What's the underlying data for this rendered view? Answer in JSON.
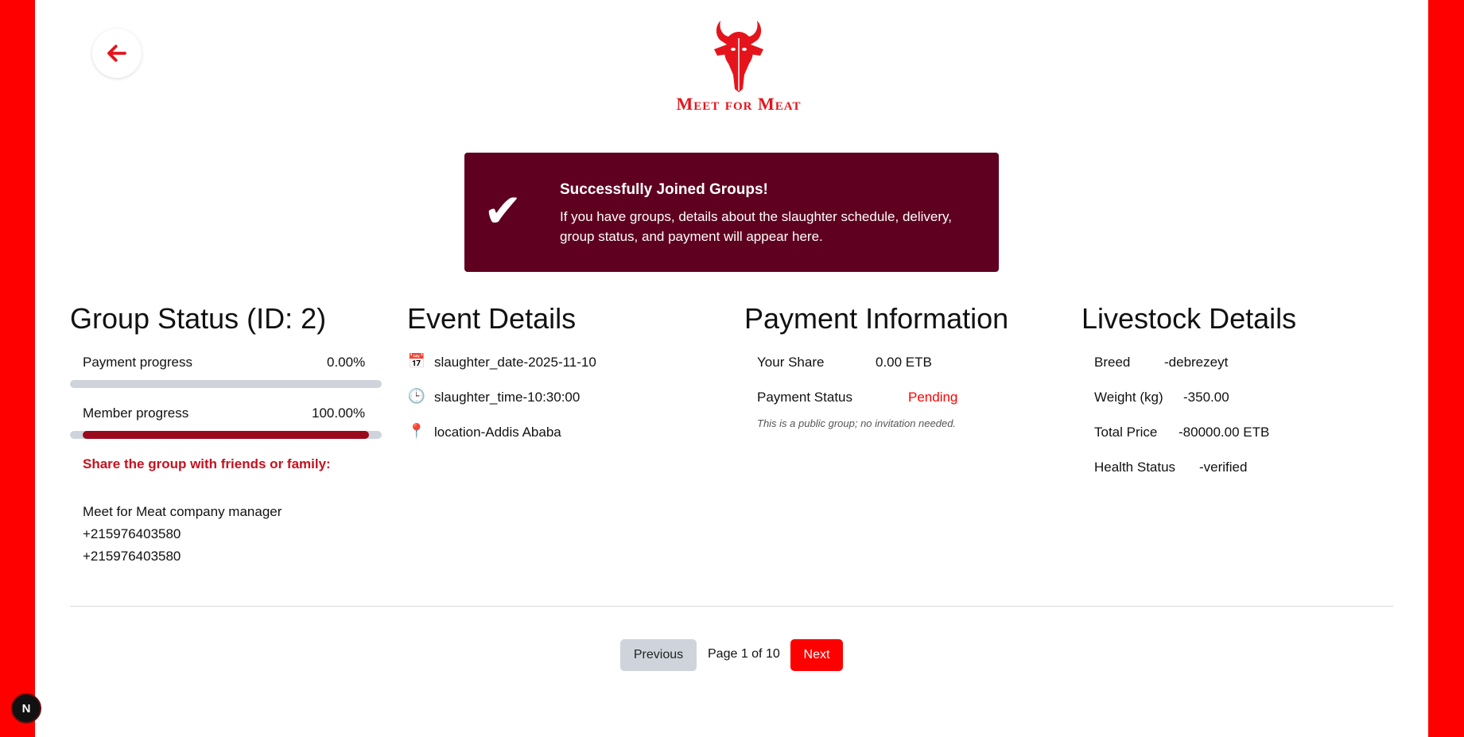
{
  "header": {
    "back_icon": "arrow-left-icon",
    "logo_text": "Meet for Meat",
    "logo_icon": "bull-head-icon",
    "brand_color": "#e5141c"
  },
  "banner": {
    "check_icon": "✔",
    "title": "Successfully Joined Groups!",
    "text": "If you have groups, details about the slaughter schedule, delivery, group status, and payment will appear here.",
    "background": "#5f0020"
  },
  "group_status": {
    "title": "Group Status (ID: 2)",
    "payment_label": "Payment progress",
    "payment_value": "0.00%",
    "payment_fraction": 0.0,
    "member_label": "Member progress",
    "member_value": "100.00%",
    "member_fraction": 1.0,
    "share_title": "Share the group with friends or family:",
    "contact_name": "Meet for Meat company manager",
    "phone_1": "+215976403580",
    "phone_2": "+215976403580"
  },
  "event": {
    "title": "Event Details",
    "date_icon": "📅",
    "date": "slaughter_date-2025-11-10",
    "time_icon": "🕒",
    "time": "slaughter_time-10:30:00",
    "location_icon": "📍",
    "location": "location-Addis Ababa"
  },
  "payment": {
    "title": "Payment Information",
    "share_label": "Your Share",
    "share_value": "0.00 ETB",
    "status_label": "Payment Status",
    "status_value": "Pending",
    "note": "This is a public group; no invitation needed."
  },
  "livestock": {
    "title": "Livestock Details",
    "breed_label": "Breed",
    "breed_value": "-debrezeyt",
    "weight_label": "Weight (kg)",
    "weight_value": "-350.00",
    "price_label": "Total Price",
    "price_value": "-80000.00 ETB",
    "health_label": "Health Status",
    "health_value": "-verified"
  },
  "pagination": {
    "previous": "Previous",
    "page_label": "Page 1 of 10",
    "next": "Next"
  },
  "dev_badge": "N"
}
